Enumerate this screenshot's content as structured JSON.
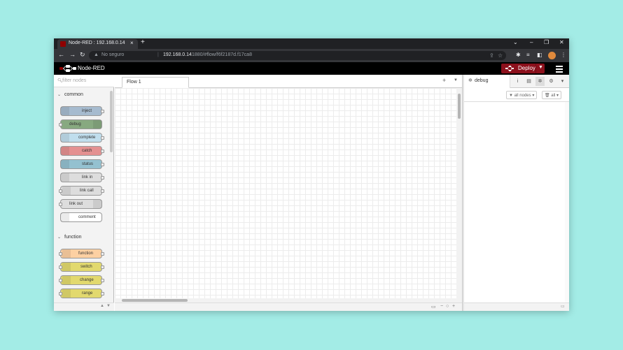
{
  "browser": {
    "tab_title": "Node-RED : 192.168.0.14",
    "tab_close": "×",
    "new_tab": "+",
    "security_label": "No seguro",
    "url_host": "192.168.0.14",
    "url_rest": ":1880/#flow/f6f2187d.f17ca8",
    "window_controls": [
      "⌄",
      "–",
      "❐",
      "✕"
    ],
    "nav": {
      "back": "←",
      "forward": "→",
      "reload": "↻"
    }
  },
  "app": {
    "title": "Node-RED",
    "deploy_label": "Deploy",
    "brand_color": "#8c101c"
  },
  "palette": {
    "filter_placeholder": "filter nodes",
    "categories": [
      {
        "label": "common",
        "nodes": [
          {
            "label": "inject",
            "color": "#a6bbcf"
          },
          {
            "label": "debug",
            "color": "#87a980"
          },
          {
            "label": "complete",
            "color": "#c0deed"
          },
          {
            "label": "catch",
            "color": "#e49191"
          },
          {
            "label": "status",
            "color": "#94c1d0"
          },
          {
            "label": "link in",
            "color": "#dddddd"
          },
          {
            "label": "link call",
            "color": "#dddddd"
          },
          {
            "label": "link out",
            "color": "#dddddd"
          },
          {
            "label": "comment",
            "color": "#ffffff"
          }
        ]
      },
      {
        "label": "function",
        "nodes": [
          {
            "label": "function",
            "color": "#fdd0a2"
          },
          {
            "label": "switch",
            "color": "#e2d96e"
          },
          {
            "label": "change",
            "color": "#e2d96e"
          },
          {
            "label": "range",
            "color": "#e2d96e"
          }
        ]
      }
    ]
  },
  "workspace": {
    "tabs": [
      {
        "label": "Flow 1"
      }
    ]
  },
  "sidebar": {
    "active_tab": "debug",
    "filter_nodes_label": "all nodes",
    "clear_label": "all"
  }
}
